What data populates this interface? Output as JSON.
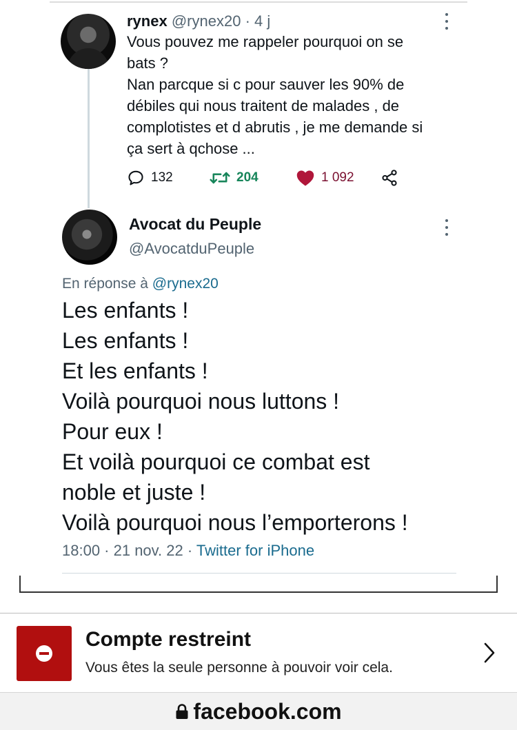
{
  "tweet1": {
    "name": "rynex",
    "handle": "@rynex20",
    "separator": "·",
    "time": "4 j",
    "text_lines": [
      "Vous pouvez me rappeler pourquoi on se",
      "bats ?",
      "Nan parcque si c pour sauver les 90% de",
      "débiles qui nous traitent de malades , de",
      "complotistes et d abrutis , je me demande si",
      "ça sert à qchose ..."
    ],
    "replies": "132",
    "retweets": "204",
    "likes": "1 092",
    "colors": {
      "retweet": "#17855a",
      "like": "#b0163a"
    }
  },
  "tweet2": {
    "name": "Avocat du Peuple",
    "handle": "@AvocatduPeuple",
    "reply_prefix": "En réponse à",
    "reply_mention": "@rynex20",
    "text_lines": [
      "Les enfants !",
      "Les enfants !",
      "Et les enfants !",
      "Voilà pourquoi nous luttons !",
      "Pour eux !",
      "Et voilà pourquoi ce combat est",
      "noble et juste !",
      "Voilà pourquoi nous l’emporterons !"
    ],
    "timestamp": "18:00 · 21 nov. 22 ·",
    "source": "Twitter for iPhone"
  },
  "restricted": {
    "title": "Compte restreint",
    "description": "Vous êtes la seule personne à pouvoir voir cela.",
    "icon": "no-entry-icon",
    "accent": "#b10f0f"
  },
  "browser": {
    "url": "facebook.com",
    "icon": "lock-icon"
  }
}
